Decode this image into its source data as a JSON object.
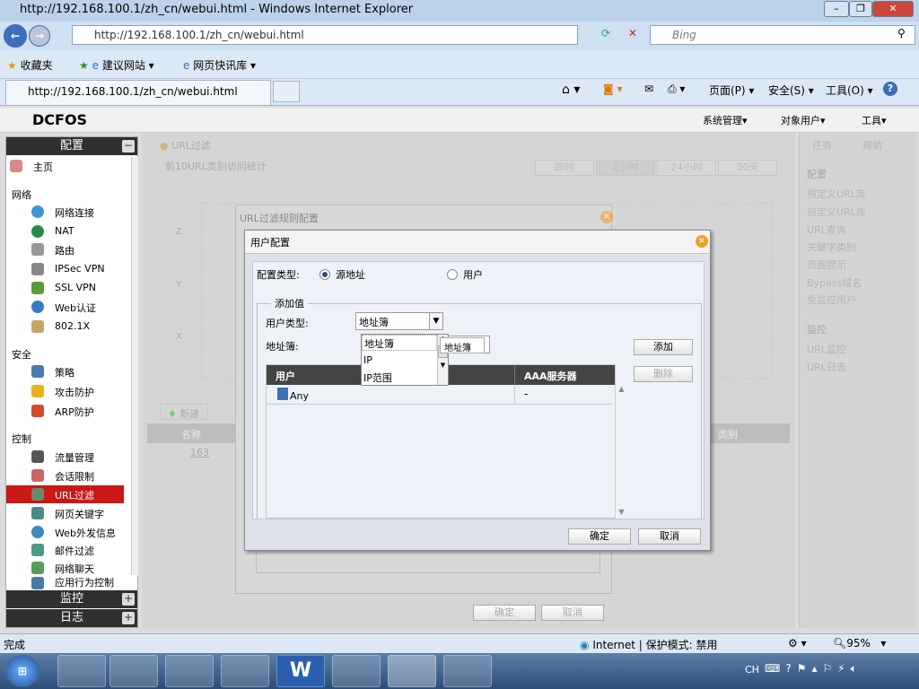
{
  "window": {
    "title": "http://192.168.100.1/zh_cn/webui.html - Windows Internet Explorer"
  },
  "browser": {
    "url": "http://192.168.100.1/zh_cn/webui.html",
    "search_placeholder": "Bing",
    "favorites": "收藏夹",
    "suggested": "建议网站",
    "webslice": "网页快讯库",
    "tab_title": "http://192.168.100.1/zh_cn/webui.html",
    "page_menu": "页面(P)",
    "safety_menu": "安全(S)",
    "tools_menu": "工具(O)"
  },
  "app": {
    "logo": "DCFOS",
    "menus": [
      "系统管理",
      "对象用户",
      "工具"
    ]
  },
  "sidebar": {
    "config_header": "配置",
    "home": "主页",
    "groups": {
      "network": "网络",
      "security": "安全",
      "control": "控制"
    },
    "network": [
      "网络连接",
      "NAT",
      "路由",
      "IPSec VPN",
      "SSL VPN",
      "Web认证",
      "802.1X"
    ],
    "security": [
      "策略",
      "攻击防护",
      "ARP防护"
    ],
    "control": [
      "流量管理",
      "会话限制",
      "URL过滤",
      "网页关键字",
      "Web外发信息",
      "邮件过滤",
      "网络聊天",
      "应用行为控制"
    ],
    "monitor_header": "监控",
    "log_header": "日志"
  },
  "main": {
    "title": "URL过滤",
    "stats_title": "前10URL类别访问统计",
    "ranges": [
      "即时",
      "1小时",
      "24小时",
      "30天"
    ],
    "axis": [
      "Z",
      "Y",
      "X"
    ],
    "new_button": "新建",
    "col_name": "名称",
    "col_category": "类别",
    "row_name": "163"
  },
  "right_panel": {
    "tabs": [
      "任务",
      "帮助"
    ],
    "config_header": "配置",
    "config_items": [
      "预定义URL库",
      "自定义URL库",
      "URL查询",
      "关键字类别",
      "页面提示",
      "Bypass域名",
      "免监控用户"
    ],
    "monitor_header": "监控",
    "monitor_items": [
      "URL监控",
      "URL日志"
    ]
  },
  "rule_dialog": {
    "title": "URL过滤规则配置",
    "ok": "确定",
    "cancel": "取消"
  },
  "user_dialog": {
    "title": "用户配置",
    "config_type_label": "配置类型:",
    "opt_source": "源地址",
    "opt_user": "用户",
    "fieldset": "添加值",
    "user_type_label": "用户类型:",
    "user_type_value": "地址簿",
    "addrbook_label": "地址簿:",
    "addrbook_value": "地址簿",
    "dropdown_options": [
      "地址簿",
      "IP",
      "IP范围"
    ],
    "add": "添加",
    "delete": "删除",
    "columns": [
      "用户",
      "AAA服务器"
    ],
    "rows": [
      {
        "user": "Any",
        "aaa": "-"
      }
    ],
    "ok": "确定",
    "cancel": "取消"
  },
  "statusbar": {
    "left": "完成",
    "zone": "Internet | 保护模式: 禁用",
    "zoom": "95%"
  },
  "taskbar": {
    "lang": "CH"
  }
}
